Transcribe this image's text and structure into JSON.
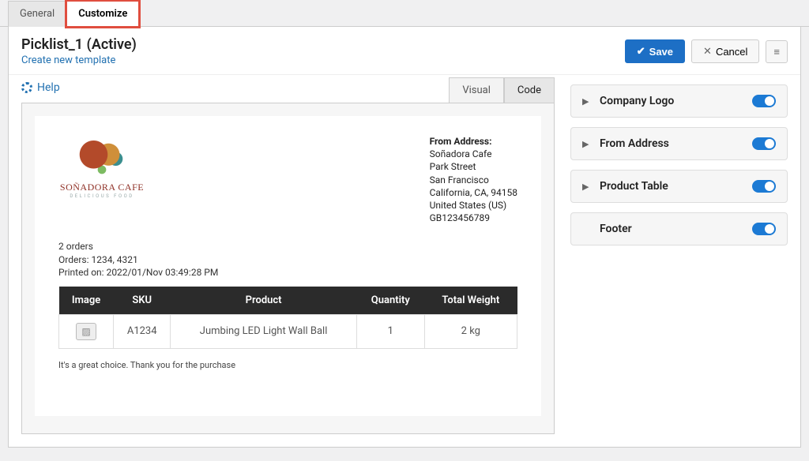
{
  "tabs": {
    "general": "General",
    "customize": "Customize"
  },
  "page": {
    "title": "Picklist_1 (Active)",
    "create_link": "Create new template"
  },
  "actions": {
    "save": "Save",
    "cancel": "Cancel"
  },
  "help": {
    "label": "Help"
  },
  "viztabs": {
    "visual": "Visual",
    "code": "Code"
  },
  "doc": {
    "brand": {
      "name": "SOÑADORA CAFE",
      "tagline": "DELICIOUS FOOD"
    },
    "from": {
      "label": "From Address:",
      "line1": "Soñadora Cafe",
      "line2": "Park Street",
      "line3": "San Francisco",
      "line4": "California, CA, 94158",
      "line5": "United States (US)",
      "line6": "GB123456789"
    },
    "orders": {
      "count": "2 orders",
      "ids": "Orders: 1234, 4321",
      "printed": "Printed on: 2022/01/Nov 03:49:28 PM"
    },
    "table": {
      "headers": {
        "image": "Image",
        "sku": "SKU",
        "product": "Product",
        "qty": "Quantity",
        "weight": "Total Weight"
      },
      "rows": [
        {
          "sku": "A1234",
          "product": "Jumbing LED Light Wall Ball",
          "qty": "1",
          "weight": "2 kg"
        }
      ]
    },
    "footer": "It's a great choice. Thank you for the purchase"
  },
  "settings": {
    "items": [
      {
        "label": "Company Logo",
        "expandable": true
      },
      {
        "label": "From Address",
        "expandable": true
      },
      {
        "label": "Product Table",
        "expandable": true
      },
      {
        "label": "Footer",
        "expandable": false
      }
    ]
  }
}
